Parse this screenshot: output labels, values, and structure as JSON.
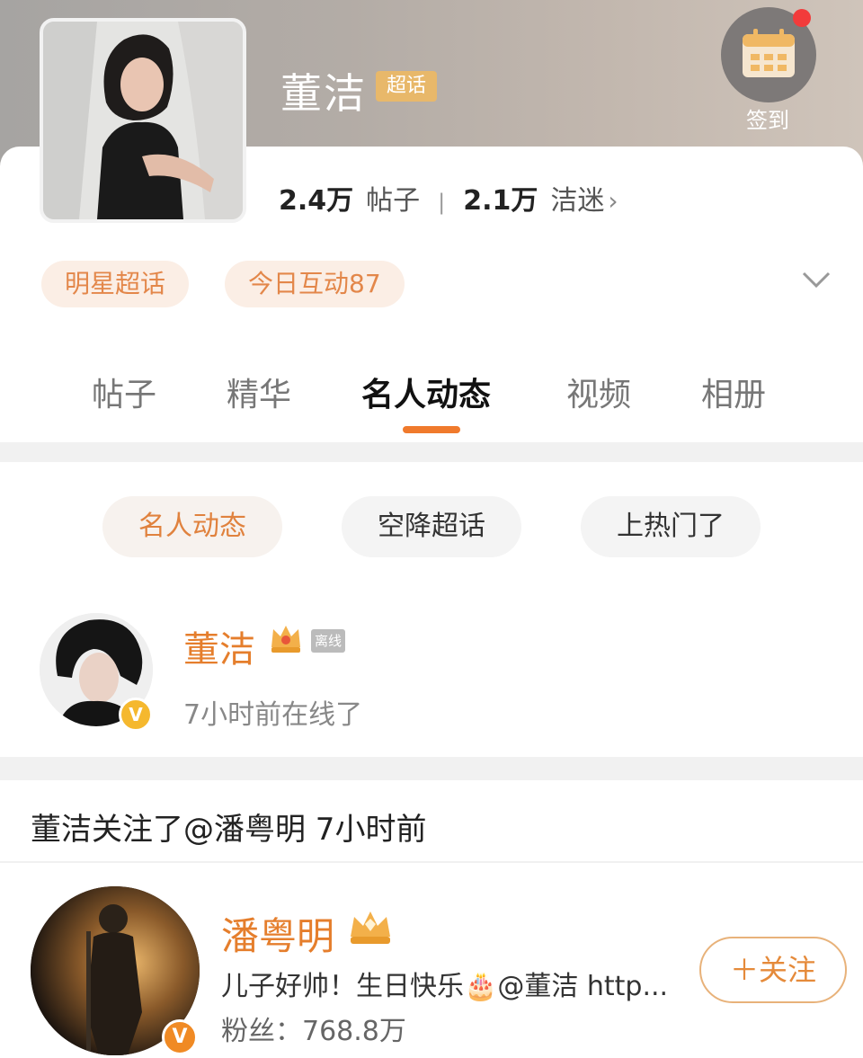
{
  "header": {
    "title": "董洁",
    "title_badge": "超话",
    "checkin_label": "签到",
    "stats": {
      "posts_count": "2.4万",
      "posts_label": "帖子",
      "fans_count": "2.1万",
      "fans_label": "洁迷"
    },
    "tags": [
      "明星超话",
      "今日互动87"
    ]
  },
  "tabs": [
    {
      "label": "帖子"
    },
    {
      "label": "精华"
    },
    {
      "label": "名人动态",
      "active": true
    },
    {
      "label": "视频"
    },
    {
      "label": "相册"
    }
  ],
  "filters": [
    {
      "label": "名人动态",
      "active": true
    },
    {
      "label": "空降超话"
    },
    {
      "label": "上热门了"
    }
  ],
  "celebrity": {
    "name": "董洁",
    "offline_badge": "离线",
    "status": "7小时前在线了"
  },
  "activity": {
    "notice": "董洁关注了@潘粤明 7小时前",
    "user": {
      "name": "潘粤明",
      "bio": "儿子好帅！生日快乐🎂@董洁 http...",
      "fans": "粉丝：768.8万",
      "follow_label": "＋关注"
    }
  },
  "colors": {
    "accent_orange": "#e57e2c",
    "tab_underline": "#f07a2c",
    "verified_gold": "#f5b82e",
    "verified_orange": "#f08a24",
    "notification_red": "#f23b3b"
  }
}
